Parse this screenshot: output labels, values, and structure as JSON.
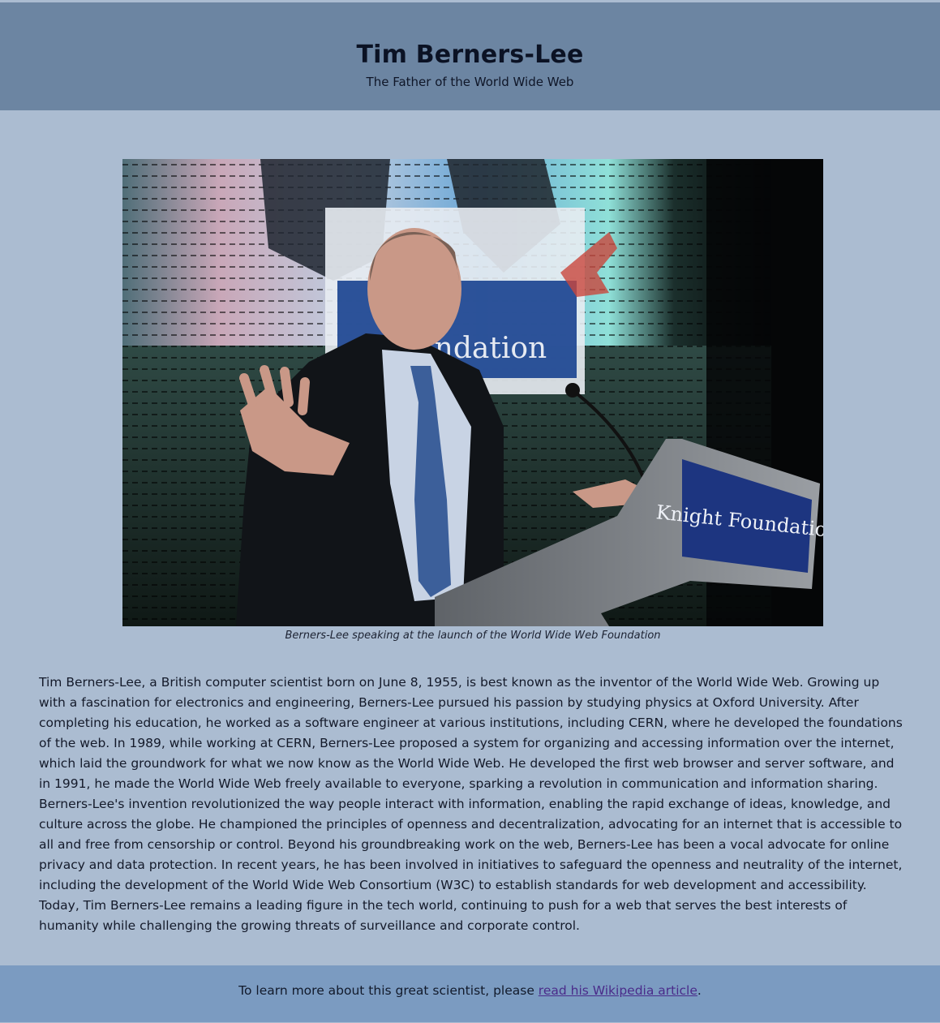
{
  "header": {
    "title": "Tim Berners-Lee",
    "subtitle": "The Father of the World Wide Web"
  },
  "figure": {
    "image_alt": "Tim Berners-Lee speaking at a podium",
    "podium_text": "Knight Foundation",
    "screen_text": "Foundation",
    "caption": "Berners-Lee speaking at the launch of the World Wide Web Foundation"
  },
  "bio": {
    "text": "Tim Berners-Lee, a British computer scientist born on June 8, 1955, is best known as the inventor of the World Wide Web. Growing up with a fascination for electronics and engineering, Berners-Lee pursued his passion by studying physics at Oxford University. After completing his education, he worked as a software engineer at various institutions, including CERN, where he developed the foundations of the web. In 1989, while working at CERN, Berners-Lee proposed a system for organizing and accessing information over the internet, which laid the groundwork for what we now know as the World Wide Web. He developed the first web browser and server software, and in 1991, he made the World Wide Web freely available to everyone, sparking a revolution in communication and information sharing. Berners-Lee's invention revolutionized the way people interact with information, enabling the rapid exchange of ideas, knowledge, and culture across the globe. He championed the principles of openness and decentralization, advocating for an internet that is accessible to all and free from censorship or control. Beyond his groundbreaking work on the web, Berners-Lee has been a vocal advocate for online privacy and data protection. In recent years, he has been involved in initiatives to safeguard the openness and neutrality of the internet, including the development of the World Wide Web Consortium (W3C) to establish standards for web development and accessibility. Today, Tim Berners-Lee remains a leading figure in the tech world, continuing to push for a web that serves the best interests of humanity while challenging the growing threats of surveillance and corporate control."
  },
  "footer": {
    "prefix": "To learn more about this great scientist, please ",
    "link_text": "read his Wikipedia article",
    "suffix": "."
  },
  "colors": {
    "page_bg": "#abbcd1",
    "header_bg": "#6c85a2",
    "footer_bg": "#7b9bc1",
    "link": "#4a2b8a"
  }
}
